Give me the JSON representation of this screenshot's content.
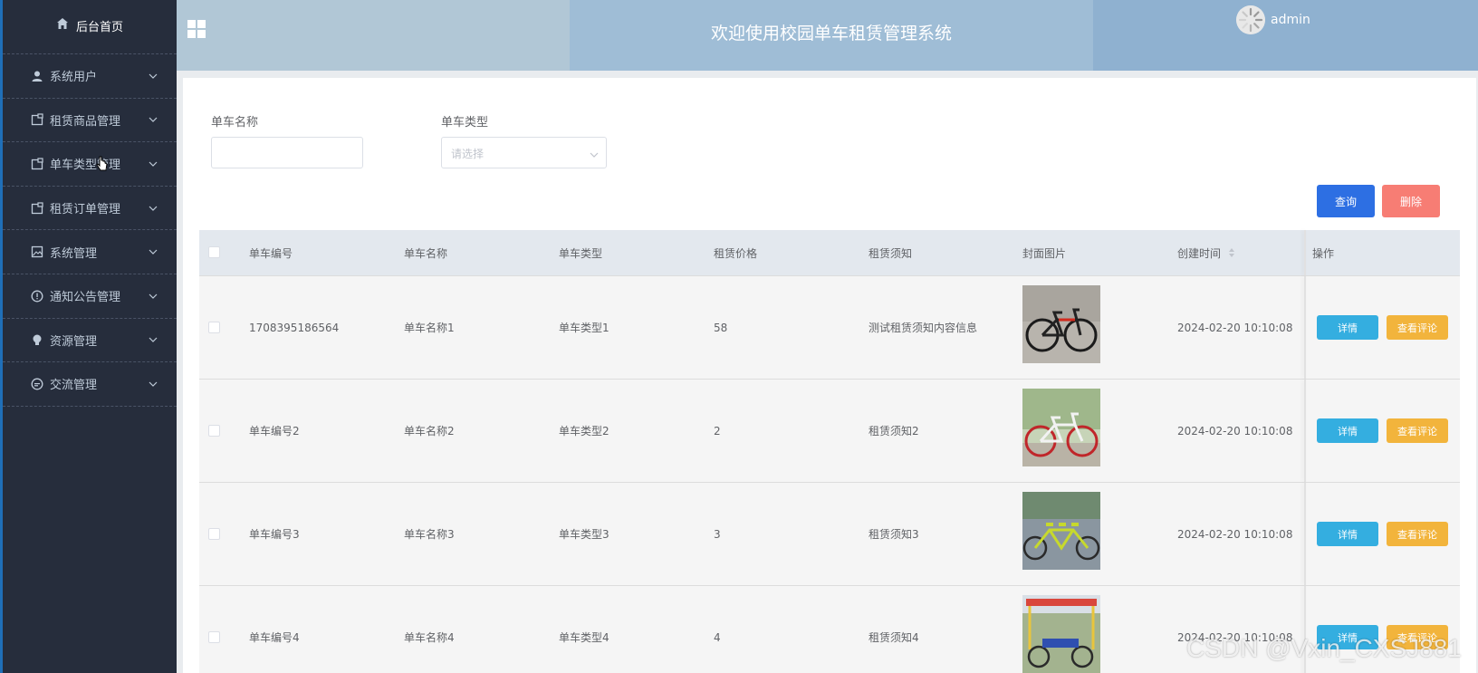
{
  "sidebar": {
    "home_label": "后台首页",
    "items": [
      {
        "label": "系统用户",
        "icon": "user-icon"
      },
      {
        "label": "租赁商品管理",
        "icon": "doc-icon"
      },
      {
        "label": "单车类型管理",
        "icon": "doc-icon"
      },
      {
        "label": "租赁订单管理",
        "icon": "doc-icon"
      },
      {
        "label": "系统管理",
        "icon": "image-icon"
      },
      {
        "label": "通知公告管理",
        "icon": "info-icon"
      },
      {
        "label": "资源管理",
        "icon": "bulb-icon"
      },
      {
        "label": "交流管理",
        "icon": "chat-icon"
      }
    ]
  },
  "header": {
    "title": "欢迎使用校园单车租赁管理系统",
    "username": "admin"
  },
  "filters": {
    "name_label": "单车名称",
    "name_value": "",
    "type_label": "单车类型",
    "type_placeholder": "请选择"
  },
  "actions": {
    "query_label": "查询",
    "delete_label": "删除"
  },
  "table": {
    "headers": [
      "单车编号",
      "单车名称",
      "单车类型",
      "租赁价格",
      "租赁须知",
      "封面图片",
      "创建时间",
      "操作"
    ],
    "rows": [
      {
        "code": "1708395186564",
        "name": "单车名称1",
        "type": "单车类型1",
        "price": "58",
        "notice": "测试租赁须知内容信息",
        "created": "2024-02-20 10:10:08"
      },
      {
        "code": "单车编号2",
        "name": "单车名称2",
        "type": "单车类型2",
        "price": "2",
        "notice": "租赁须知2",
        "created": "2024-02-20 10:10:08"
      },
      {
        "code": "单车编号3",
        "name": "单车名称3",
        "type": "单车类型3",
        "price": "3",
        "notice": "租赁须知3",
        "created": "2024-02-20 10:10:08"
      },
      {
        "code": "单车编号4",
        "name": "单车名称4",
        "type": "单车类型4",
        "price": "4",
        "notice": "租赁须知4",
        "created": "2024-02-20 10:10:08"
      }
    ],
    "detail_label": "详情",
    "review_label": "查看评论"
  },
  "watermark": "CSDN @Vxin_CXSJ881"
}
